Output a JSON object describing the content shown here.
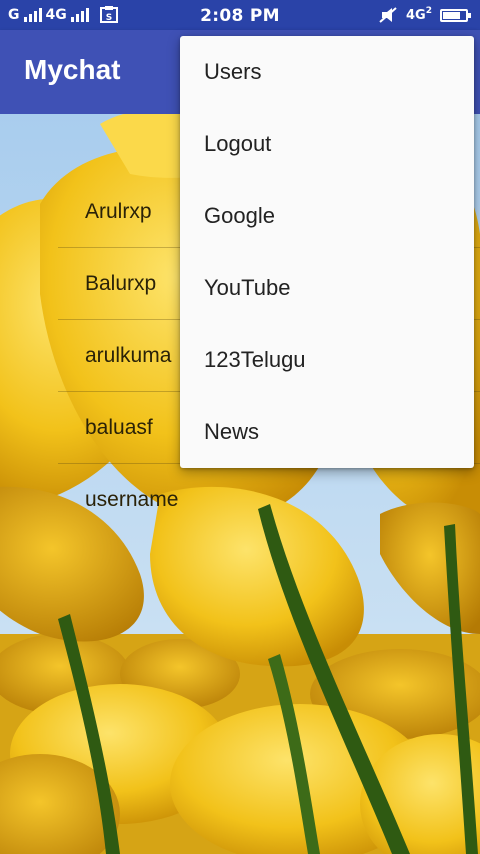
{
  "status_bar": {
    "carrier_left": "G",
    "network_2": "4G",
    "time": "2:08 PM",
    "network_right": "4G",
    "network_right_sub": "2"
  },
  "app_bar": {
    "title": "Mychat"
  },
  "users": [
    {
      "name": "Arulrxp"
    },
    {
      "name": "Balurxp"
    },
    {
      "name": "arulkuma"
    },
    {
      "name": "baluasf"
    },
    {
      "name": "username"
    }
  ],
  "menu": {
    "items": [
      {
        "label": "Users"
      },
      {
        "label": "Logout"
      },
      {
        "label": "Google"
      },
      {
        "label": "YouTube"
      },
      {
        "label": "123Telugu"
      },
      {
        "label": "News"
      }
    ]
  },
  "colors": {
    "app_bar": "#3f51b5",
    "status_bar": "#2a43a8",
    "menu_background": "#fafafa",
    "tulip_yellow": "#f2c21a"
  }
}
